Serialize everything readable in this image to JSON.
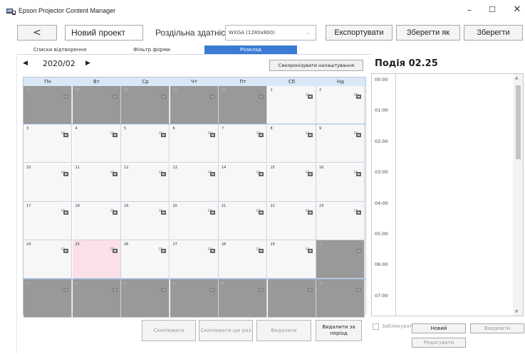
{
  "window": {
    "title": "Epson Projector Content Manager",
    "minimize": "–",
    "maximize": "☐",
    "close": "✕"
  },
  "toolbar": {
    "back": "<",
    "project_name": "Новий проект",
    "resolution_label": "Роздільна здатність :",
    "resolution_value": "WXGA (1280x800)",
    "export": "Експортувати",
    "save_as": "Зберегти як",
    "save": "Зберегти"
  },
  "tabs": [
    {
      "label": "Списки відтворення",
      "active": false
    },
    {
      "label": "Фільтр форми",
      "active": false
    },
    {
      "label": "Розклад",
      "active": true
    }
  ],
  "calendar": {
    "month": "2020/02",
    "sync_button": "Синхронізувати налаштування",
    "days_of_week": [
      "Пн",
      "Вт",
      "Ср",
      "Чт",
      "Пт",
      "Сб",
      "Нд"
    ],
    "weeks": [
      [
        {
          "d": "27",
          "in": false
        },
        {
          "d": "28",
          "in": false
        },
        {
          "d": "29",
          "in": false
        },
        {
          "d": "30",
          "in": false
        },
        {
          "d": "31",
          "in": false
        },
        {
          "d": "1",
          "in": true
        },
        {
          "d": "2",
          "in": true
        }
      ],
      [
        {
          "d": "3",
          "in": true
        },
        {
          "d": "4",
          "in": true
        },
        {
          "d": "5",
          "in": true
        },
        {
          "d": "6",
          "in": true
        },
        {
          "d": "7",
          "in": true
        },
        {
          "d": "8",
          "in": true
        },
        {
          "d": "9",
          "in": true
        }
      ],
      [
        {
          "d": "10",
          "in": true
        },
        {
          "d": "11",
          "in": true
        },
        {
          "d": "12",
          "in": true
        },
        {
          "d": "13",
          "in": true
        },
        {
          "d": "14",
          "in": true
        },
        {
          "d": "15",
          "in": true
        },
        {
          "d": "16",
          "in": true
        }
      ],
      [
        {
          "d": "17",
          "in": true
        },
        {
          "d": "18",
          "in": true
        },
        {
          "d": "19",
          "in": true
        },
        {
          "d": "20",
          "in": true
        },
        {
          "d": "21",
          "in": true
        },
        {
          "d": "22",
          "in": true
        },
        {
          "d": "23",
          "in": true
        }
      ],
      [
        {
          "d": "24",
          "in": true
        },
        {
          "d": "25",
          "in": true,
          "selected": true
        },
        {
          "d": "26",
          "in": true
        },
        {
          "d": "27",
          "in": true
        },
        {
          "d": "28",
          "in": true
        },
        {
          "d": "29",
          "in": true
        },
        {
          "d": "1",
          "in": false
        }
      ],
      [
        {
          "d": "2",
          "in": false
        },
        {
          "d": "3",
          "in": false
        },
        {
          "d": "4",
          "in": false
        },
        {
          "d": "5",
          "in": false
        },
        {
          "d": "6",
          "in": false
        },
        {
          "d": "7",
          "in": false
        },
        {
          "d": "8",
          "in": false
        }
      ]
    ]
  },
  "calendar_actions": {
    "copy": "Скопіювати",
    "copy_again": "Скопіювати ще раз",
    "delete": "Видалити",
    "delete_period": "Видалити за період"
  },
  "event_panel": {
    "title": "Подія 02.25",
    "hours": [
      "00:00",
      "01:00",
      "02:00",
      "03:00",
      "04:00",
      "05:00",
      "06:00",
      "07:00"
    ],
    "lock_label": "Заблокувати",
    "new": "Новий",
    "delete": "Видалити",
    "edit": "Редагувати"
  },
  "colors": {
    "accent": "#3a7bd5",
    "header_bg": "#d9e7f7",
    "inactive_day": "#999999",
    "selected_day": "#fbe0ea"
  }
}
